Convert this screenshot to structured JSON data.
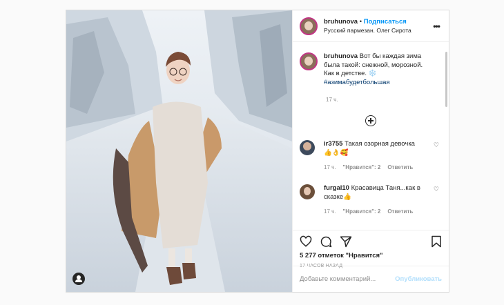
{
  "post": {
    "username": "bruhunova",
    "dot": "•",
    "follow_label": "Подписаться",
    "location": "Русский пармезан. Олег Сирота",
    "more_icon": "more-horizontal-icon",
    "caption_username": "bruhunova",
    "caption_text": "Вот бы каждая зима была такой: снежной, морозной. Как в детстве. ❄️",
    "hashtag": "#азимабудетбольшая",
    "caption_time": "17 ч.",
    "likes": "5 277 отметок \"Нравится\"",
    "posted_ago": "17 ЧАСОВ НАЗАД"
  },
  "comments": [
    {
      "username": "ir3755",
      "text": "Такая озорная девочка 👍👌🥰",
      "time": "17 ч.",
      "likes": "\"Нравится\": 2",
      "reply": "Ответить"
    },
    {
      "username": "furgal10",
      "text": "Красавица Таня...как в сказке👍",
      "time": "17 ч.",
      "likes": "\"Нравится\": 2",
      "reply": "Ответить"
    }
  ],
  "add_comment": {
    "placeholder": "Добавьте комментарий...",
    "publish_label": "Опубликовать"
  },
  "colors": {
    "accent": "#0095f6",
    "publish_disabled": "#b2dffc",
    "hashtag": "#00376b"
  }
}
